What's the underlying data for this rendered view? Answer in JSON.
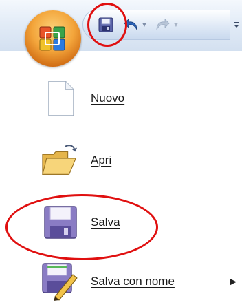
{
  "quick_access": {
    "save_icon": "save-icon",
    "undo_icon": "undo-icon",
    "redo_icon": "redo-icon",
    "customize_icon": "customize-qat-icon"
  },
  "office_menu": {
    "items": [
      {
        "label": "Nuovo",
        "icon": "new-document-icon"
      },
      {
        "label": "Apri",
        "icon": "open-folder-icon"
      },
      {
        "label": "Salva",
        "icon": "save-icon"
      },
      {
        "label": "Salva con nome",
        "icon": "save-as-icon",
        "has_submenu": true
      }
    ],
    "submenu_arrow": "▶"
  },
  "colors": {
    "highlight": "#e01010",
    "office_orange": "#f3a53b",
    "disk_purple": "#7a6bb0"
  }
}
